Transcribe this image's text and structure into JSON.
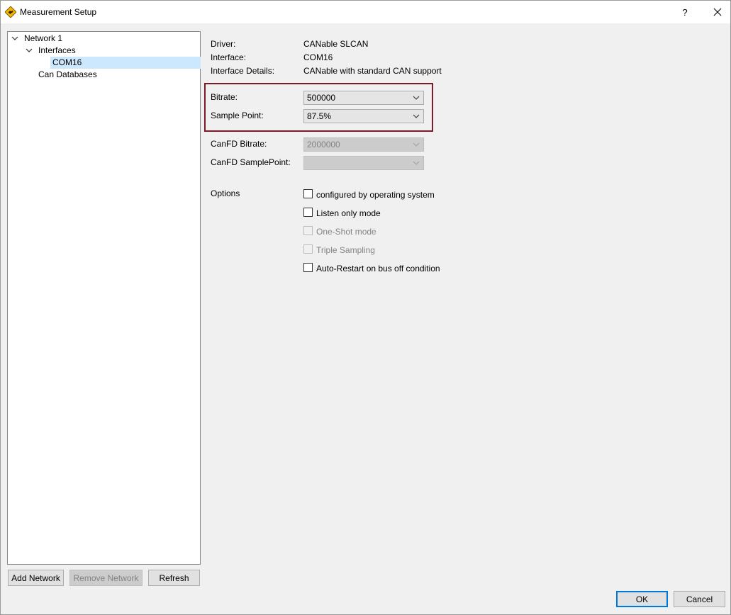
{
  "window": {
    "title": "Measurement Setup",
    "help_label": "?",
    "close_label": "✕"
  },
  "tree": {
    "network": "Network 1",
    "interfaces": "Interfaces",
    "interface_item": "COM16",
    "databases": "Can Databases"
  },
  "left_buttons": {
    "add_network": "Add Network",
    "remove_network": "Remove Network",
    "refresh": "Refresh"
  },
  "details": {
    "driver_label": "Driver:",
    "driver_value": "CANable SLCAN",
    "interface_label": "Interface:",
    "interface_value": "COM16",
    "interface_details_label": "Interface Details:",
    "interface_details_value": "CANable with standard CAN support"
  },
  "settings": {
    "bitrate_label": "Bitrate:",
    "bitrate_value": "500000",
    "sample_point_label": "Sample Point:",
    "sample_point_value": "87.5%",
    "canfd_bitrate_label": "CanFD Bitrate:",
    "canfd_bitrate_value": "2000000",
    "canfd_samplepoint_label": "CanFD SamplePoint:",
    "canfd_samplepoint_value": ""
  },
  "options": {
    "label": "Options",
    "items": [
      {
        "label": "configured by operating system",
        "checked": false,
        "enabled": true
      },
      {
        "label": "Listen only mode",
        "checked": false,
        "enabled": true
      },
      {
        "label": "One-Shot mode",
        "checked": false,
        "enabled": false
      },
      {
        "label": "Triple Sampling",
        "checked": false,
        "enabled": false
      },
      {
        "label": "Auto-Restart on bus off condition",
        "checked": false,
        "enabled": true
      }
    ]
  },
  "dialog_buttons": {
    "ok": "OK",
    "cancel": "Cancel"
  },
  "colors": {
    "highlight_border": "#7b1a2a",
    "selection": "#cce8ff",
    "default_button_border": "#0078d7"
  }
}
